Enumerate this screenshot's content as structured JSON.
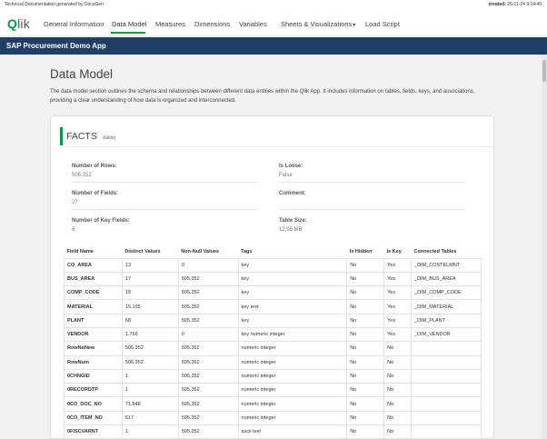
{
  "top": {
    "left": "Technical Documentation generated by DocuGen",
    "created_label": "created:",
    "created_value": "26-11-24 9:14:49"
  },
  "logo": "Qlik",
  "nav": {
    "items": [
      "General Information",
      "Data Model",
      "Measures",
      "Dimensions",
      "Variables",
      "Sheets & Visualizations",
      "Load Script"
    ],
    "active": "Data Model",
    "dropdown_caret": "▾"
  },
  "app_title": "SAP Procurement Demo App",
  "page": {
    "title": "Data Model",
    "description": "The data model section outlines the schema and relationships between different data entities within the Qlik App. It includes information on tables, fields, keys, and associations, providing a clear understanding of how data is organized and interconnected."
  },
  "table_card": {
    "name": "FACTS",
    "tag": "(table)",
    "stats": {
      "rows_label": "Number of Rows:",
      "rows_value": "505.352",
      "fields_label": "Number of Fields:",
      "fields_value": "27",
      "keys_label": "Number of Key Fields:",
      "keys_value": "6",
      "loose_label": "Is Loose:",
      "loose_value": "False",
      "comment_label": "Comment:",
      "comment_value": "",
      "size_label": "Table Size:",
      "size_value": "12,95 MB"
    },
    "columns": [
      "Field Name",
      "Distinct Values",
      "Non-Null Values",
      "Tags",
      "Is Hidden",
      "Is Key",
      "Connected Tables"
    ],
    "rows": [
      [
        "CO_AREA",
        "13",
        "0",
        "key",
        "No",
        "Yes",
        "_DIM_COSTELMNT"
      ],
      [
        "BUS_AREA",
        "17",
        "505.352",
        "key",
        "No",
        "Yes",
        "_DIM_BUS_AREA"
      ],
      [
        "COMP_CODE",
        "18",
        "505.352",
        "key",
        "No",
        "Yes",
        "_DIM_COMP_CODE"
      ],
      [
        "MATERIAL",
        "15.195",
        "505.352",
        "key text",
        "No",
        "Yes",
        "_DIM_MATERIAL"
      ],
      [
        "PLANT",
        "68",
        "505.352",
        "key",
        "No",
        "Yes",
        "_DIM_PLANT"
      ],
      [
        "VENDOR",
        "1.766",
        "0",
        "key numeric integer",
        "No",
        "Yes",
        "_DIM_VENDOR"
      ],
      [
        "RowNoNew",
        "505.352",
        "505.352",
        "numeric integer",
        "No",
        "No",
        ""
      ],
      [
        "RowNum",
        "505.352",
        "505.352",
        "numeric integer",
        "No",
        "No",
        ""
      ],
      [
        "0CHNGID",
        "1",
        "505.352",
        "numeric integer",
        "No",
        "No",
        ""
      ],
      [
        "0RECORDTP",
        "1",
        "505.352",
        "numeric integer",
        "No",
        "No",
        ""
      ],
      [
        "0CO_DOC_NO",
        "71.848",
        "505.352",
        "numeric integer",
        "No",
        "No",
        ""
      ],
      [
        "0CO_ITEM_NO",
        "617",
        "505.352",
        "numeric integer",
        "No",
        "No",
        ""
      ],
      [
        "0FISCVARNT",
        "1",
        "505.352",
        "ascii text",
        "No",
        "No",
        ""
      ]
    ]
  }
}
